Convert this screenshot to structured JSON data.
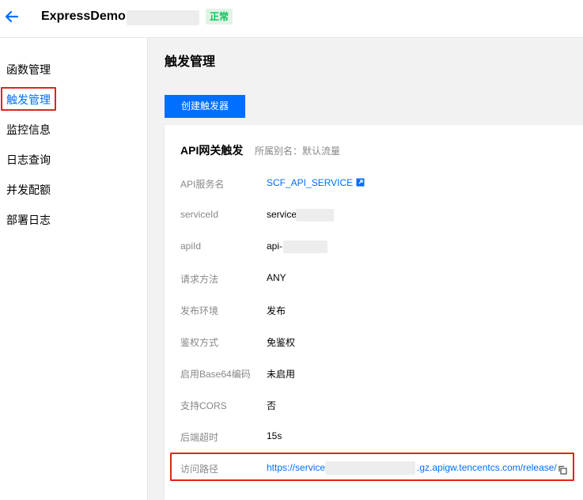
{
  "header": {
    "back_icon": "arrow-left-icon",
    "title": "ExpressDemo",
    "status": "正常",
    "accent": "#006eff",
    "status_color": "#0abf5b"
  },
  "sidebar": {
    "items": [
      {
        "label": "函数管理",
        "active": false
      },
      {
        "label": "触发管理",
        "active": true
      },
      {
        "label": "监控信息",
        "active": false
      },
      {
        "label": "日志查询",
        "active": false
      },
      {
        "label": "并发配额",
        "active": false
      },
      {
        "label": "部署日志",
        "active": false
      }
    ]
  },
  "main": {
    "title": "触发管理",
    "create_button": "创建触发器"
  },
  "trigger": {
    "title": "API网关触发",
    "subtitle": "所属别名：默认流量",
    "rows": [
      {
        "label": "API服务名",
        "value": "SCF_API_SERVICE",
        "link": true,
        "icon": "external-link-icon"
      },
      {
        "label": "serviceId",
        "value": "service-"
      },
      {
        "label": "apiId",
        "value": "api-"
      },
      {
        "label": "请求方法",
        "value": "ANY"
      },
      {
        "label": "发布环境",
        "value": "发布"
      },
      {
        "label": "鉴权方式",
        "value": "免鉴权"
      },
      {
        "label": "启用Base64编码",
        "value": "未启用"
      },
      {
        "label": "支持CORS",
        "value": "否"
      },
      {
        "label": "后端超时",
        "value": "15s"
      },
      {
        "label": "访问路径",
        "value_prefix": "https://service",
        "value_suffix": ".gz.apigw.tencentcs.com/release/",
        "link": true,
        "icon": "copy-icon"
      }
    ]
  }
}
